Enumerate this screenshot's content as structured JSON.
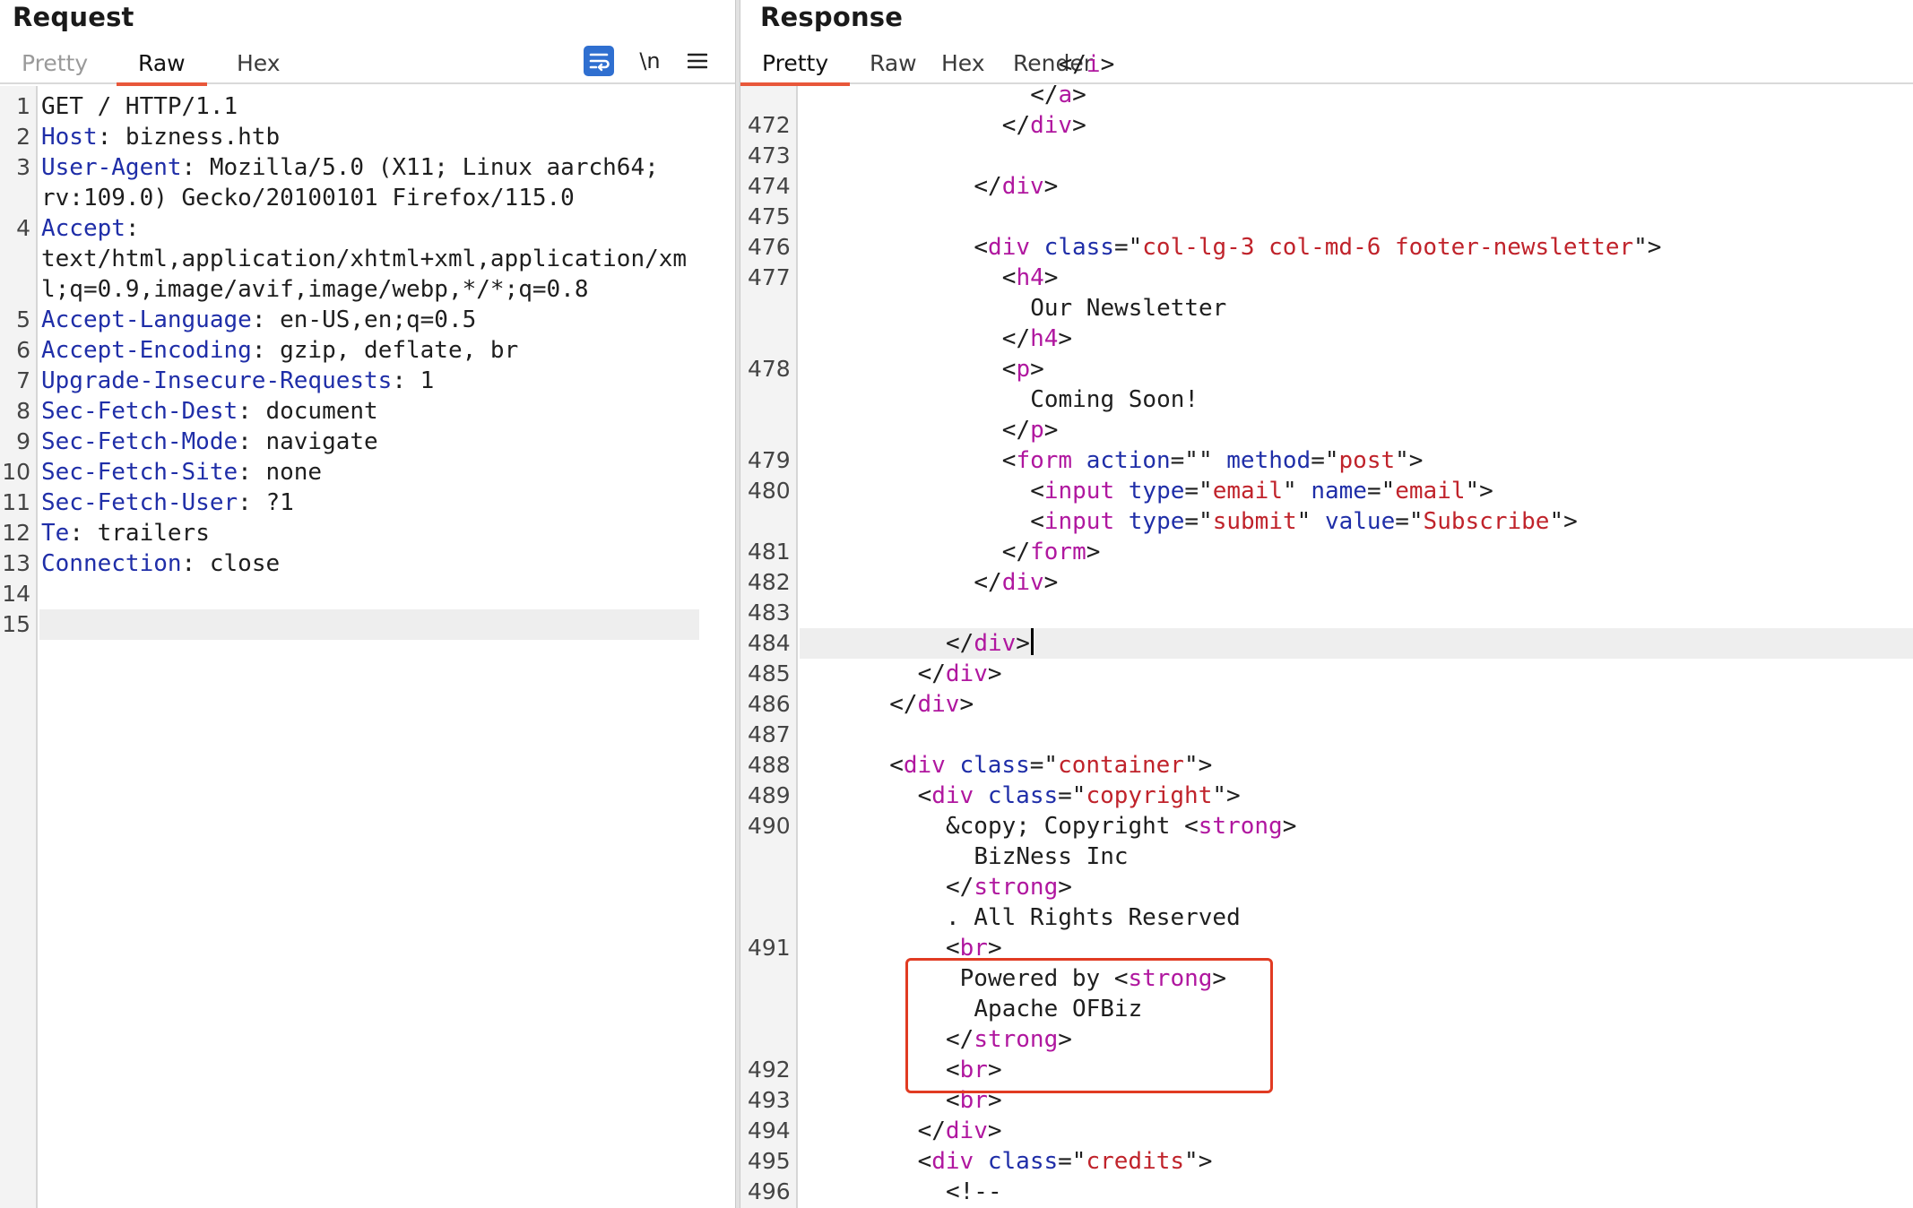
{
  "request": {
    "title": "Request",
    "tabs": [
      "Pretty",
      "Raw",
      "Hex"
    ],
    "active_tab": "Raw",
    "icons": [
      "wrap-lines-icon",
      "newline-icon",
      "menu-icon"
    ],
    "newline_icon_text": "\\n",
    "lines": [
      {
        "n": "1",
        "key": "",
        "rest": "GET / HTTP/1.1"
      },
      {
        "n": "2",
        "key": "Host",
        "rest": ": bizness.htb"
      },
      {
        "n": "3",
        "key": "User-Agent",
        "rest": ": Mozilla/5.0 (X11; Linux aarch64;"
      },
      {
        "n": "",
        "key": "",
        "rest": "rv:109.0) Gecko/20100101 Firefox/115.0"
      },
      {
        "n": "4",
        "key": "Accept",
        "rest": ":"
      },
      {
        "n": "",
        "key": "",
        "rest": "text/html,application/xhtml+xml,application/xm"
      },
      {
        "n": "",
        "key": "",
        "rest": "l;q=0.9,image/avif,image/webp,*/*;q=0.8"
      },
      {
        "n": "5",
        "key": "Accept-Language",
        "rest": ": en-US,en;q=0.5"
      },
      {
        "n": "6",
        "key": "Accept-Encoding",
        "rest": ": gzip, deflate, br"
      },
      {
        "n": "7",
        "key": "Upgrade-Insecure-Requests",
        "rest": ": 1"
      },
      {
        "n": "8",
        "key": "Sec-Fetch-Dest",
        "rest": ": document"
      },
      {
        "n": "9",
        "key": "Sec-Fetch-Mode",
        "rest": ": navigate"
      },
      {
        "n": "10",
        "key": "Sec-Fetch-Site",
        "rest": ": none"
      },
      {
        "n": "11",
        "key": "Sec-Fetch-User",
        "rest": ": ?1"
      },
      {
        "n": "12",
        "key": "Te",
        "rest": ": trailers"
      },
      {
        "n": "13",
        "key": "Connection",
        "rest": ": close"
      },
      {
        "n": "14",
        "key": "",
        "rest": ""
      },
      {
        "n": "15",
        "key": "",
        "rest": "",
        "current": true
      }
    ]
  },
  "response": {
    "title": "Response",
    "tabs": [
      "Pretty",
      "Raw",
      "Hex",
      "Render"
    ],
    "active_tab": "Pretty",
    "lines": [
      {
        "n": "",
        "indent": 9,
        "parts": [
          [
            "p",
            "</"
          ],
          [
            "t",
            "i"
          ],
          [
            "p",
            ">"
          ]
        ]
      },
      {
        "n": "",
        "indent": 8,
        "parts": [
          [
            "p",
            "</"
          ],
          [
            "t",
            "a"
          ],
          [
            "p",
            ">"
          ]
        ]
      },
      {
        "n": "472",
        "indent": 7,
        "parts": [
          [
            "p",
            "</"
          ],
          [
            "t",
            "div"
          ],
          [
            "p",
            ">"
          ]
        ]
      },
      {
        "n": "473",
        "indent": 0,
        "parts": []
      },
      {
        "n": "474",
        "indent": 6,
        "parts": [
          [
            "p",
            "</"
          ],
          [
            "t",
            "div"
          ],
          [
            "p",
            ">"
          ]
        ]
      },
      {
        "n": "475",
        "indent": 0,
        "parts": []
      },
      {
        "n": "476",
        "indent": 6,
        "parts": [
          [
            "p",
            "<"
          ],
          [
            "t",
            "div"
          ],
          [
            "p",
            " "
          ],
          [
            "a",
            "class"
          ],
          [
            "p",
            "=\""
          ],
          [
            "v",
            "col-lg-3 col-md-6 footer-newsletter"
          ],
          [
            "p",
            "\">"
          ]
        ]
      },
      {
        "n": "477",
        "indent": 7,
        "parts": [
          [
            "p",
            "<"
          ],
          [
            "t",
            "h4"
          ],
          [
            "p",
            ">"
          ]
        ]
      },
      {
        "n": "",
        "indent": 8,
        "parts": [
          [
            "p",
            "Our Newsletter"
          ]
        ]
      },
      {
        "n": "",
        "indent": 7,
        "parts": [
          [
            "p",
            "</"
          ],
          [
            "t",
            "h4"
          ],
          [
            "p",
            ">"
          ]
        ]
      },
      {
        "n": "478",
        "indent": 7,
        "parts": [
          [
            "p",
            "<"
          ],
          [
            "t",
            "p"
          ],
          [
            "p",
            ">"
          ]
        ]
      },
      {
        "n": "",
        "indent": 8,
        "parts": [
          [
            "p",
            "Coming Soon!"
          ]
        ]
      },
      {
        "n": "",
        "indent": 7,
        "parts": [
          [
            "p",
            "</"
          ],
          [
            "t",
            "p"
          ],
          [
            "p",
            ">"
          ]
        ]
      },
      {
        "n": "479",
        "indent": 7,
        "parts": [
          [
            "p",
            "<"
          ],
          [
            "t",
            "form"
          ],
          [
            "p",
            " "
          ],
          [
            "a",
            "action"
          ],
          [
            "p",
            "=\"\" "
          ],
          [
            "a",
            "method"
          ],
          [
            "p",
            "=\""
          ],
          [
            "v",
            "post"
          ],
          [
            "p",
            "\">"
          ]
        ]
      },
      {
        "n": "480",
        "indent": 8,
        "parts": [
          [
            "p",
            "<"
          ],
          [
            "t",
            "input"
          ],
          [
            "p",
            " "
          ],
          [
            "a",
            "type"
          ],
          [
            "p",
            "=\""
          ],
          [
            "v",
            "email"
          ],
          [
            "p",
            "\" "
          ],
          [
            "a",
            "name"
          ],
          [
            "p",
            "=\""
          ],
          [
            "v",
            "email"
          ],
          [
            "p",
            "\">"
          ]
        ]
      },
      {
        "n": "",
        "indent": 8,
        "parts": [
          [
            "p",
            "<"
          ],
          [
            "t",
            "input"
          ],
          [
            "p",
            " "
          ],
          [
            "a",
            "type"
          ],
          [
            "p",
            "=\""
          ],
          [
            "v",
            "submit"
          ],
          [
            "p",
            "\" "
          ],
          [
            "a",
            "value"
          ],
          [
            "p",
            "=\""
          ],
          [
            "v",
            "Subscribe"
          ],
          [
            "p",
            "\">"
          ]
        ]
      },
      {
        "n": "481",
        "indent": 7,
        "parts": [
          [
            "p",
            "</"
          ],
          [
            "t",
            "form"
          ],
          [
            "p",
            ">"
          ]
        ]
      },
      {
        "n": "482",
        "indent": 6,
        "parts": [
          [
            "p",
            "</"
          ],
          [
            "t",
            "div"
          ],
          [
            "p",
            ">"
          ]
        ]
      },
      {
        "n": "483",
        "indent": 0,
        "parts": []
      },
      {
        "n": "484",
        "indent": 5,
        "parts": [
          [
            "p",
            "</"
          ],
          [
            "t",
            "div"
          ],
          [
            "p",
            ">"
          ]
        ],
        "current": true
      },
      {
        "n": "485",
        "indent": 4,
        "parts": [
          [
            "p",
            "</"
          ],
          [
            "t",
            "div"
          ],
          [
            "p",
            ">"
          ]
        ]
      },
      {
        "n": "486",
        "indent": 3,
        "parts": [
          [
            "p",
            "</"
          ],
          [
            "t",
            "div"
          ],
          [
            "p",
            ">"
          ]
        ]
      },
      {
        "n": "487",
        "indent": 0,
        "parts": []
      },
      {
        "n": "488",
        "indent": 3,
        "parts": [
          [
            "p",
            "<"
          ],
          [
            "t",
            "div"
          ],
          [
            "p",
            " "
          ],
          [
            "a",
            "class"
          ],
          [
            "p",
            "=\""
          ],
          [
            "v",
            "container"
          ],
          [
            "p",
            "\">"
          ]
        ]
      },
      {
        "n": "489",
        "indent": 4,
        "parts": [
          [
            "p",
            "<"
          ],
          [
            "t",
            "div"
          ],
          [
            "p",
            " "
          ],
          [
            "a",
            "class"
          ],
          [
            "p",
            "=\""
          ],
          [
            "v",
            "copyright"
          ],
          [
            "p",
            "\">"
          ]
        ]
      },
      {
        "n": "490",
        "indent": 5,
        "parts": [
          [
            "p",
            "&copy; Copyright <"
          ],
          [
            "t",
            "strong"
          ],
          [
            "p",
            ">"
          ]
        ]
      },
      {
        "n": "",
        "indent": 6,
        "parts": [
          [
            "p",
            "BizNess Inc"
          ]
        ]
      },
      {
        "n": "",
        "indent": 5,
        "parts": [
          [
            "p",
            "</"
          ],
          [
            "t",
            "strong"
          ],
          [
            "p",
            ">"
          ]
        ]
      },
      {
        "n": "",
        "indent": 5,
        "parts": [
          [
            "p",
            ". All Rights Reserved"
          ]
        ]
      },
      {
        "n": "491",
        "indent": 5,
        "parts": [
          [
            "p",
            "<"
          ],
          [
            "t",
            "br"
          ],
          [
            "p",
            ">"
          ]
        ]
      },
      {
        "n": "",
        "indent": 5,
        "parts": [
          [
            "p",
            " Powered by <"
          ],
          [
            "t",
            "strong"
          ],
          [
            "p",
            ">"
          ]
        ]
      },
      {
        "n": "",
        "indent": 6,
        "parts": [
          [
            "p",
            "Apache OFBiz"
          ]
        ]
      },
      {
        "n": "",
        "indent": 5,
        "parts": [
          [
            "p",
            "</"
          ],
          [
            "t",
            "strong"
          ],
          [
            "p",
            ">"
          ]
        ]
      },
      {
        "n": "492",
        "indent": 5,
        "parts": [
          [
            "p",
            "<"
          ],
          [
            "t",
            "br"
          ],
          [
            "p",
            ">"
          ]
        ]
      },
      {
        "n": "493",
        "indent": 5,
        "parts": [
          [
            "p",
            "<"
          ],
          [
            "t",
            "br"
          ],
          [
            "p",
            ">"
          ]
        ]
      },
      {
        "n": "494",
        "indent": 4,
        "parts": [
          [
            "p",
            "</"
          ],
          [
            "t",
            "div"
          ],
          [
            "p",
            ">"
          ]
        ]
      },
      {
        "n": "495",
        "indent": 4,
        "parts": [
          [
            "p",
            "<"
          ],
          [
            "t",
            "div"
          ],
          [
            "p",
            " "
          ],
          [
            "a",
            "class"
          ],
          [
            "p",
            "=\""
          ],
          [
            "v",
            "credits"
          ],
          [
            "p",
            "\">"
          ]
        ]
      },
      {
        "n": "496",
        "indent": 5,
        "parts": [
          [
            "p",
            "<!--"
          ]
        ]
      }
    ]
  },
  "colors": {
    "accent_tab_underline": "#e8573a",
    "annotation_box": "#e13b22",
    "header_key": "#1f2ea8",
    "tag_name": "#b0179f",
    "attr_value": "#c0232b"
  }
}
